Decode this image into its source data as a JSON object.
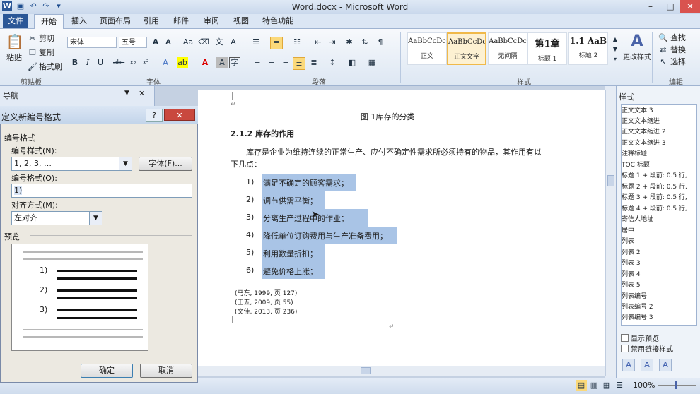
{
  "window": {
    "title": "Word.docx - Microsoft Word"
  },
  "tabs": [
    "文件",
    "开始",
    "插入",
    "页面布局",
    "引用",
    "邮件",
    "审阅",
    "视图",
    "特色功能"
  ],
  "ribbon": {
    "clipboard": {
      "paste": "粘贴",
      "cut": "剪切",
      "copy": "复制",
      "format_painter": "格式刷",
      "label": "剪贴板"
    },
    "font": {
      "name": "宋体",
      "size": "五号",
      "label": "字体"
    },
    "paragraph": {
      "label": "段落"
    },
    "styles": {
      "items": [
        {
          "preview": "AaBbCcDc",
          "name": "正文"
        },
        {
          "preview": "AaBbCcDc",
          "name": "正文文字"
        },
        {
          "preview": "AaBbCcDc",
          "name": "无间隔"
        },
        {
          "preview": "第1章",
          "name": "标题 1"
        },
        {
          "preview": "1.1 AaB",
          "name": "标题 2"
        }
      ],
      "change_styles": "更改样式",
      "label": "样式"
    },
    "editing": {
      "find": "查找",
      "replace": "替换",
      "select": "选择",
      "label": "编辑"
    }
  },
  "nav": {
    "title": "导航"
  },
  "document": {
    "caption": "图 1库存的分类",
    "heading": "2.1.2 库存的作用",
    "para_line1": "库存是企业为维持连续的正常生产、应付不确定性需求所必须持有的物品，其作用有以",
    "para_line2": "下几点：",
    "items": [
      {
        "num": "1)",
        "text": "满足不确定的顾客需求；"
      },
      {
        "num": "2)",
        "text": "调节供需平衡；"
      },
      {
        "num": "3)",
        "text": "分离生产过程中的作业；"
      },
      {
        "num": "4)",
        "text": "降低单位订购费用与生产准备费用；"
      },
      {
        "num": "5)",
        "text": "利用数量折扣；"
      },
      {
        "num": "6)",
        "text": "避免价格上涨；"
      }
    ],
    "refs": [
      "(马东, 1999, 页 127)",
      "(王五, 2009, 页 55)",
      "(文佳, 2013, 页 236)"
    ]
  },
  "styles_pane": {
    "title": "样式",
    "items": [
      "正文文本 3",
      "正文文本缩进",
      "正文文本缩进 2",
      "正文文本缩进 3",
      "注释标题",
      "TOC 标题",
      "标题 1 + 段前: 0.5 行,",
      "标题 2 + 段前: 0.5 行,",
      "标题 3 + 段前: 0.5 行,",
      "标题 4 + 段前: 0.5 行,",
      "寄信人地址",
      "居中",
      "列表",
      "列表 2",
      "列表 3",
      "列表 4",
      "列表 5",
      "列表编号",
      "列表编号 2",
      "列表编号 3"
    ],
    "show_preview": "显示预览",
    "disable_linked": "禁用链接样式"
  },
  "status": {
    "zoom": "100%"
  },
  "dialog": {
    "title": "定义新编号格式",
    "section": "编号格式",
    "style_label": "编号样式(N):",
    "style_value": "1, 2, 3, …",
    "font_button": "字体(F)...",
    "format_label": "编号格式(O):",
    "format_value": "1)",
    "align_label": "对齐方式(M):",
    "align_value": "左对齐",
    "preview_label": "预览",
    "preview_nums": [
      "1)",
      "2)",
      "3)"
    ],
    "ok": "确定",
    "cancel": "取消"
  }
}
